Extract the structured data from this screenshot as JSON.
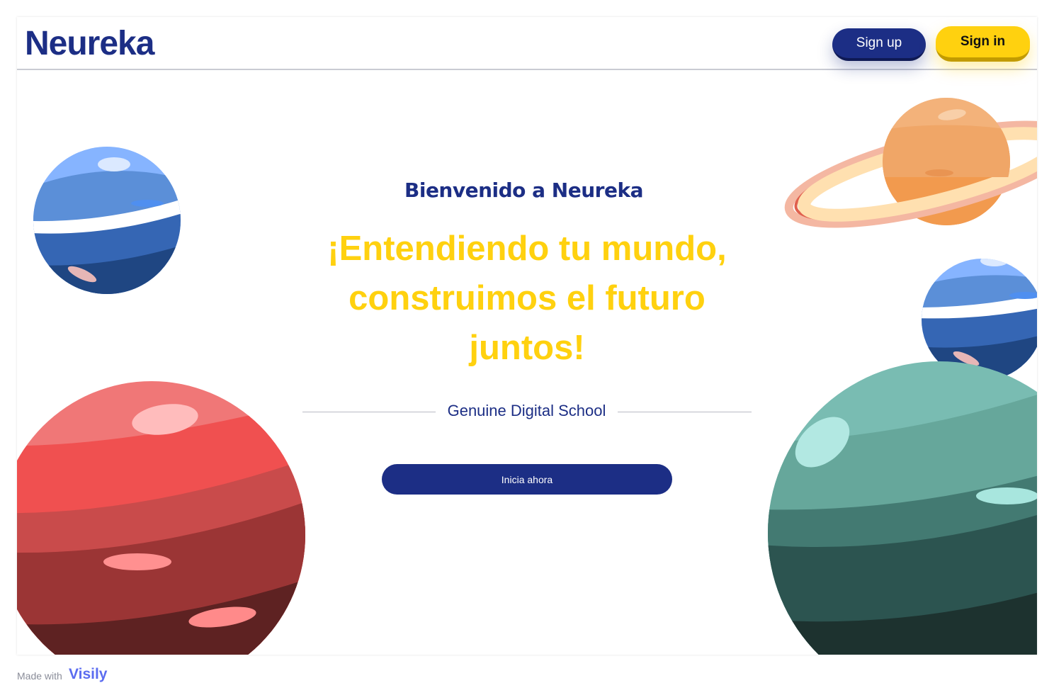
{
  "header": {
    "logo_text": "Neureka",
    "signup_label": "Sign up",
    "signin_label": "Sign in"
  },
  "hero": {
    "welcome": "Bienvenido a Neureka",
    "headline": "¡Entendiendo tu mundo, construimos el futuro juntos!",
    "tagline": "Genuine Digital School",
    "cta_label": "Inicia ahora"
  },
  "footer": {
    "made_with": "Made with",
    "brand": "Visily"
  },
  "colors": {
    "brand_navy": "#1c2e85",
    "brand_yellow": "#ffd10f"
  }
}
